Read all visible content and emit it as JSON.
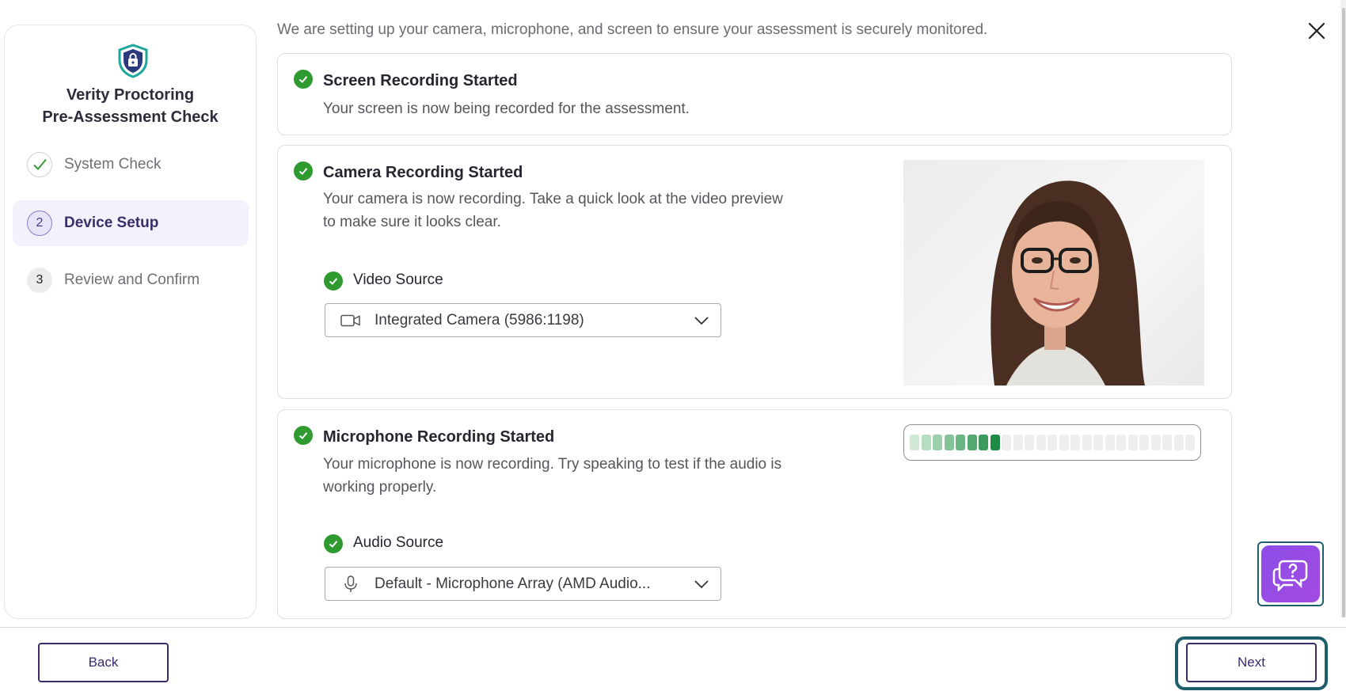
{
  "sidebar": {
    "title_line1": "Verity Proctoring",
    "title_line2": "Pre-Assessment Check",
    "icon": "shield-lock-icon",
    "steps": [
      {
        "number": "",
        "label": "System Check",
        "state": "done"
      },
      {
        "number": "2",
        "label": "Device Setup",
        "state": "active"
      },
      {
        "number": "3",
        "label": "Review and Confirm",
        "state": "pending"
      }
    ]
  },
  "main": {
    "intro": "We are setting up your camera, microphone, and screen to ensure your assessment is securely monitored.",
    "screen": {
      "title": "Screen Recording Started",
      "description": "Your screen is now being recorded for the assessment."
    },
    "camera": {
      "title": "Camera Recording Started",
      "description_line1": "Your camera is now recording. Take a quick look at the video preview",
      "description_line2": "to make sure it looks clear.",
      "source_label": "Video Source",
      "source_value": "Integrated Camera (5986:1198)"
    },
    "microphone": {
      "title": "Microphone Recording Started",
      "description_line1": "Your microphone is now recording. Try speaking to test if the audio is",
      "description_line2": "working properly.",
      "source_label": "Audio Source",
      "source_value": "Default - Microphone Array (AMD Audio...",
      "level_segments_total": 25,
      "level_segments_active": 8
    }
  },
  "footer": {
    "back_label": "Back",
    "next_label": "Next"
  },
  "colors": {
    "accent": "#3c2a6b",
    "success": "#2f9a30",
    "help_button": "#9a4be4",
    "focus_ring": "#1d5e6a"
  }
}
